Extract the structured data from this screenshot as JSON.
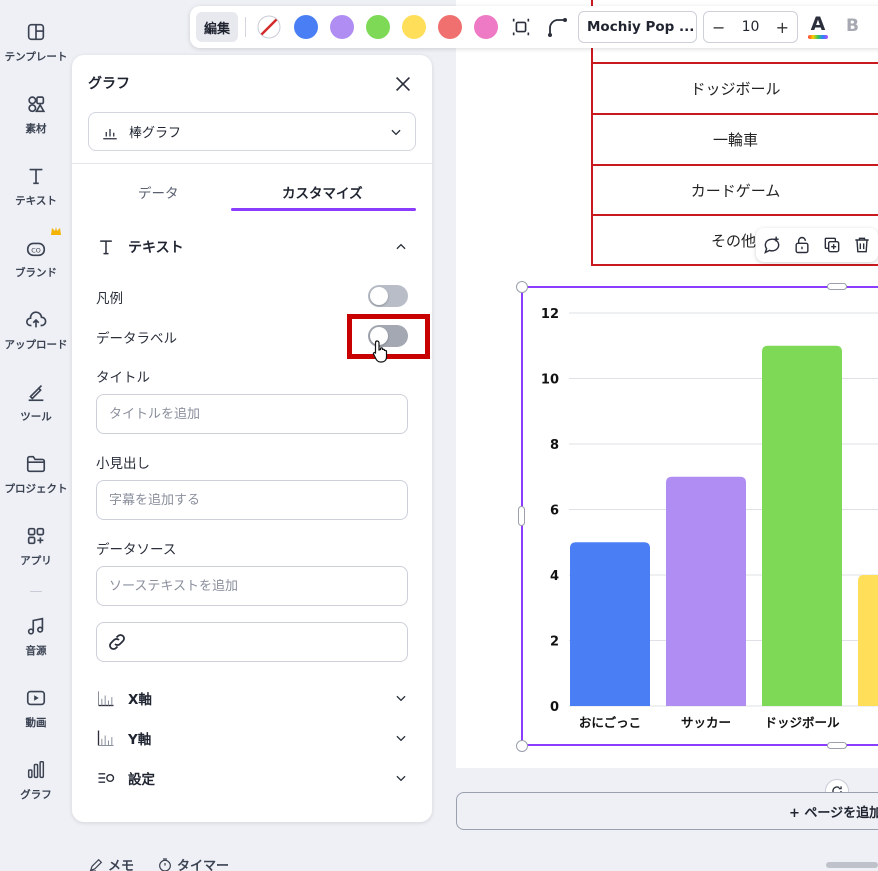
{
  "rail": [
    {
      "label": "テンプレート",
      "icon": "template-icon"
    },
    {
      "label": "素材",
      "icon": "elements-icon"
    },
    {
      "label": "テキスト",
      "icon": "text-icon"
    },
    {
      "label": "ブランド",
      "icon": "brand-icon"
    },
    {
      "label": "アップロード",
      "icon": "upload-icon"
    },
    {
      "label": "ツール",
      "icon": "tools-icon"
    },
    {
      "label": "プロジェクト",
      "icon": "folder-icon"
    },
    {
      "label": "アプリ",
      "icon": "apps-icon"
    },
    {
      "label": "音源",
      "icon": "music-icon"
    },
    {
      "label": "動画",
      "icon": "video-icon"
    },
    {
      "label": "グラフ",
      "icon": "chart-icon"
    }
  ],
  "panel": {
    "title": "グラフ",
    "chart_type": "棒グラフ",
    "tabs": [
      "データ",
      "カスタマイズ"
    ],
    "text_section": "テキスト",
    "legend_label": "凡例",
    "data_label": "データラベル",
    "title_label": "タイトル",
    "title_placeholder": "タイトルを追加",
    "subtitle_label": "小見出し",
    "subtitle_placeholder": "字幕を追加する",
    "source_label": "データソース",
    "source_placeholder": "ソーステキストを追加",
    "x_axis": "X軸",
    "y_axis": "Y軸",
    "settings": "設定",
    "legend_on": false,
    "data_label_on": false
  },
  "bottom": {
    "notes": "メモ",
    "timer": "タイマー"
  },
  "toolbar": {
    "edit": "編集",
    "colors": [
      "#4a7ef5",
      "#af8df3",
      "#7ed957",
      "#ffde59",
      "#f06f6f",
      "#ee79c4"
    ],
    "font": "Mochiy Pop ...",
    "size": "10",
    "minus": "−",
    "plus": "+",
    "text_color_glyph": "A",
    "bold_glyph": "B"
  },
  "table_rows": [
    "ドッジボール",
    "一輪車",
    "カードゲーム",
    "その他"
  ],
  "add_page": "+ ページを追加",
  "chart_data": {
    "type": "bar",
    "categories": [
      "おにごっこ",
      "サッカー",
      "ドッジボール",
      ""
    ],
    "values": [
      5,
      7,
      11,
      4
    ],
    "colors": [
      "#4a7ef5",
      "#af8df3",
      "#7ed957",
      "#ffde59"
    ],
    "ylim": [
      0,
      12
    ],
    "yticks": [
      0,
      2,
      4,
      6,
      8,
      10,
      12
    ],
    "grid": true
  }
}
